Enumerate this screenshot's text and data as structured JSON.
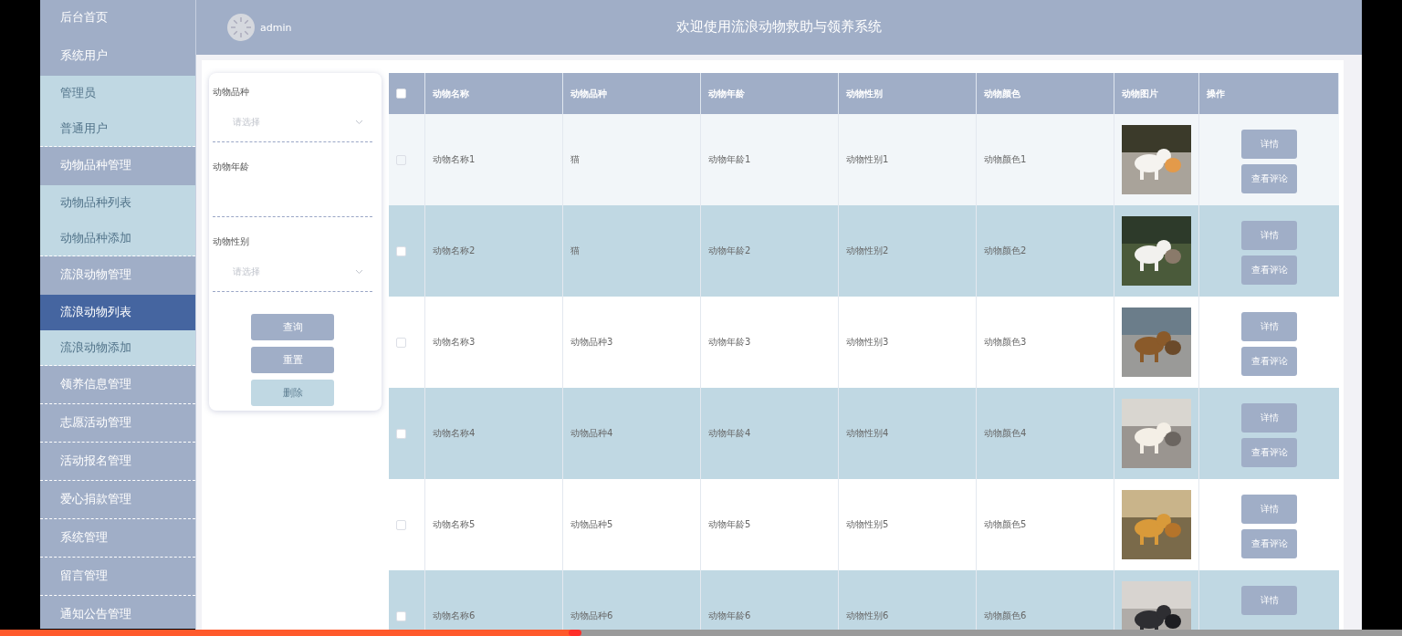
{
  "header": {
    "user": "admin",
    "title": "欢迎使用流浪动物救助与领养系统"
  },
  "sidebar": {
    "items": [
      {
        "label": "后台首页",
        "kind": "group",
        "selected": false
      },
      {
        "label": "系统用户",
        "kind": "group",
        "selected": false
      },
      {
        "label": "管理员",
        "kind": "sub",
        "selected": false
      },
      {
        "label": "普通用户",
        "kind": "sub",
        "selected": false
      },
      {
        "label": "动物品种管理",
        "kind": "group",
        "selected": false
      },
      {
        "label": "动物品种列表",
        "kind": "sub",
        "selected": false
      },
      {
        "label": "动物品种添加",
        "kind": "sub",
        "selected": false
      },
      {
        "label": "流浪动物管理",
        "kind": "group",
        "selected": false
      },
      {
        "label": "流浪动物列表",
        "kind": "sub",
        "selected": true
      },
      {
        "label": "流浪动物添加",
        "kind": "sub",
        "selected": false
      },
      {
        "label": "领养信息管理",
        "kind": "group",
        "selected": false
      },
      {
        "label": "志愿活动管理",
        "kind": "group",
        "selected": false
      },
      {
        "label": "活动报名管理",
        "kind": "group",
        "selected": false
      },
      {
        "label": "爱心捐款管理",
        "kind": "group",
        "selected": false
      },
      {
        "label": "系统管理",
        "kind": "group",
        "selected": false
      },
      {
        "label": "留言管理",
        "kind": "group",
        "selected": false
      },
      {
        "label": "通知公告管理",
        "kind": "group",
        "selected": false
      }
    ]
  },
  "filters": {
    "fields": [
      {
        "label": "动物品种",
        "kind": "select",
        "placeholder": "请选择"
      },
      {
        "label": "动物年龄",
        "kind": "input"
      },
      {
        "label": "动物性别",
        "kind": "select",
        "placeholder": "请选择"
      }
    ],
    "buttons": [
      {
        "label": "查询",
        "disabled": false
      },
      {
        "label": "重置",
        "disabled": false
      },
      {
        "label": "删除",
        "disabled": true
      }
    ]
  },
  "table": {
    "select_all": {
      "checked": false
    },
    "columns": [
      "动物名称",
      "动物品种",
      "动物年龄",
      "动物性别",
      "动物颜色",
      "动物图片",
      "操作"
    ],
    "rows": [
      {
        "name": "动物名称1",
        "breed": "猫",
        "age": "动物年龄1",
        "gender": "动物性别1",
        "animal_color": "动物颜色1",
        "picture": {
          "kind": "picture"
        },
        "actions": [
          "详情",
          "查看评论"
        ],
        "highlighted": true,
        "checked": false
      },
      {
        "name": "动物名称2",
        "breed": "猫",
        "age": "动物年龄2",
        "gender": "动物性别2",
        "animal_color": "动物颜色2",
        "picture": {
          "kind": "picture"
        },
        "actions": [
          "详情",
          "查看评论"
        ],
        "highlighted": false,
        "checked": false
      },
      {
        "name": "动物名称3",
        "breed": "动物品种3",
        "age": "动物年龄3",
        "gender": "动物性别3",
        "animal_color": "动物颜色3",
        "picture": {
          "kind": "picture"
        },
        "actions": [
          "详情",
          "查看评论"
        ],
        "highlighted": false,
        "checked": false
      },
      {
        "name": "动物名称4",
        "breed": "动物品种4",
        "age": "动物年龄4",
        "gender": "动物性别4",
        "animal_color": "动物颜色4",
        "picture": {
          "kind": "picture"
        },
        "actions": [
          "详情",
          "查看评论"
        ],
        "highlighted": false,
        "checked": false
      },
      {
        "name": "动物名称5",
        "breed": "动物品种5",
        "age": "动物年龄5",
        "gender": "动物性别5",
        "animal_color": "动物颜色5",
        "picture": {
          "kind": "picture"
        },
        "actions": [
          "详情",
          "查看评论"
        ],
        "highlighted": false,
        "checked": false
      },
      {
        "name": "动物名称6",
        "breed": "动物品种6",
        "age": "动物年龄6",
        "gender": "动物性别6",
        "animal_color": "动物颜色6",
        "picture": {
          "kind": "picture"
        },
        "actions": [
          "详情"
        ],
        "highlighted": false,
        "checked": false
      }
    ]
  },
  "player": {
    "level": 0.41
  }
}
